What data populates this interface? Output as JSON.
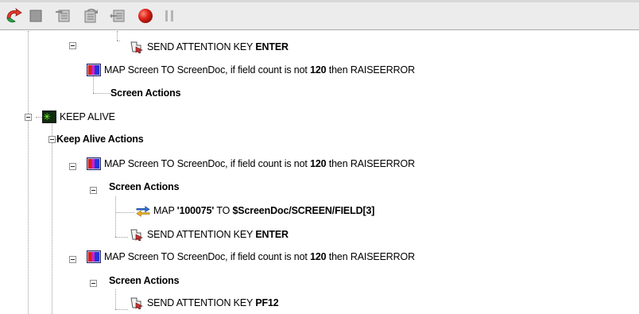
{
  "toolbar": {
    "buttons": [
      {
        "name": "run-icon"
      },
      {
        "name": "stop-icon"
      },
      {
        "name": "step-into-icon"
      },
      {
        "name": "step-over-icon"
      },
      {
        "name": "step-out-icon"
      },
      {
        "name": "record-icon"
      },
      {
        "name": "pause-icon"
      }
    ]
  },
  "tree": {
    "n1": {
      "pre": "SEND ATTENTION KEY ",
      "bold": "ENTER"
    },
    "n2": {
      "pre": "MAP Screen TO ScreenDoc, if field count is not ",
      "bold": "120",
      "post": " then RAISEERROR"
    },
    "n3": {
      "bold": "Screen Actions"
    },
    "n4": {
      "pre": "KEEP ALIVE"
    },
    "n5": {
      "bold": "Keep Alive Actions"
    },
    "n6": {
      "pre": "MAP Screen TO ScreenDoc, if field count is not ",
      "bold": "120",
      "post": " then RAISEERROR"
    },
    "n7": {
      "bold": "Screen Actions"
    },
    "n8": {
      "pre": "MAP ",
      "bold1": "'100075'",
      "mid": " TO ",
      "bold2": "$ScreenDoc/SCREEN/FIELD[3]"
    },
    "n9": {
      "pre": "SEND ATTENTION KEY ",
      "bold": "ENTER"
    },
    "n10": {
      "pre": "MAP Screen TO ScreenDoc, if field count is not ",
      "bold": "120",
      "post": " then RAISEERROR"
    },
    "n11": {
      "bold": "Screen Actions"
    },
    "n12": {
      "pre": "SEND ATTENTION KEY ",
      "bold": "PF12"
    }
  }
}
